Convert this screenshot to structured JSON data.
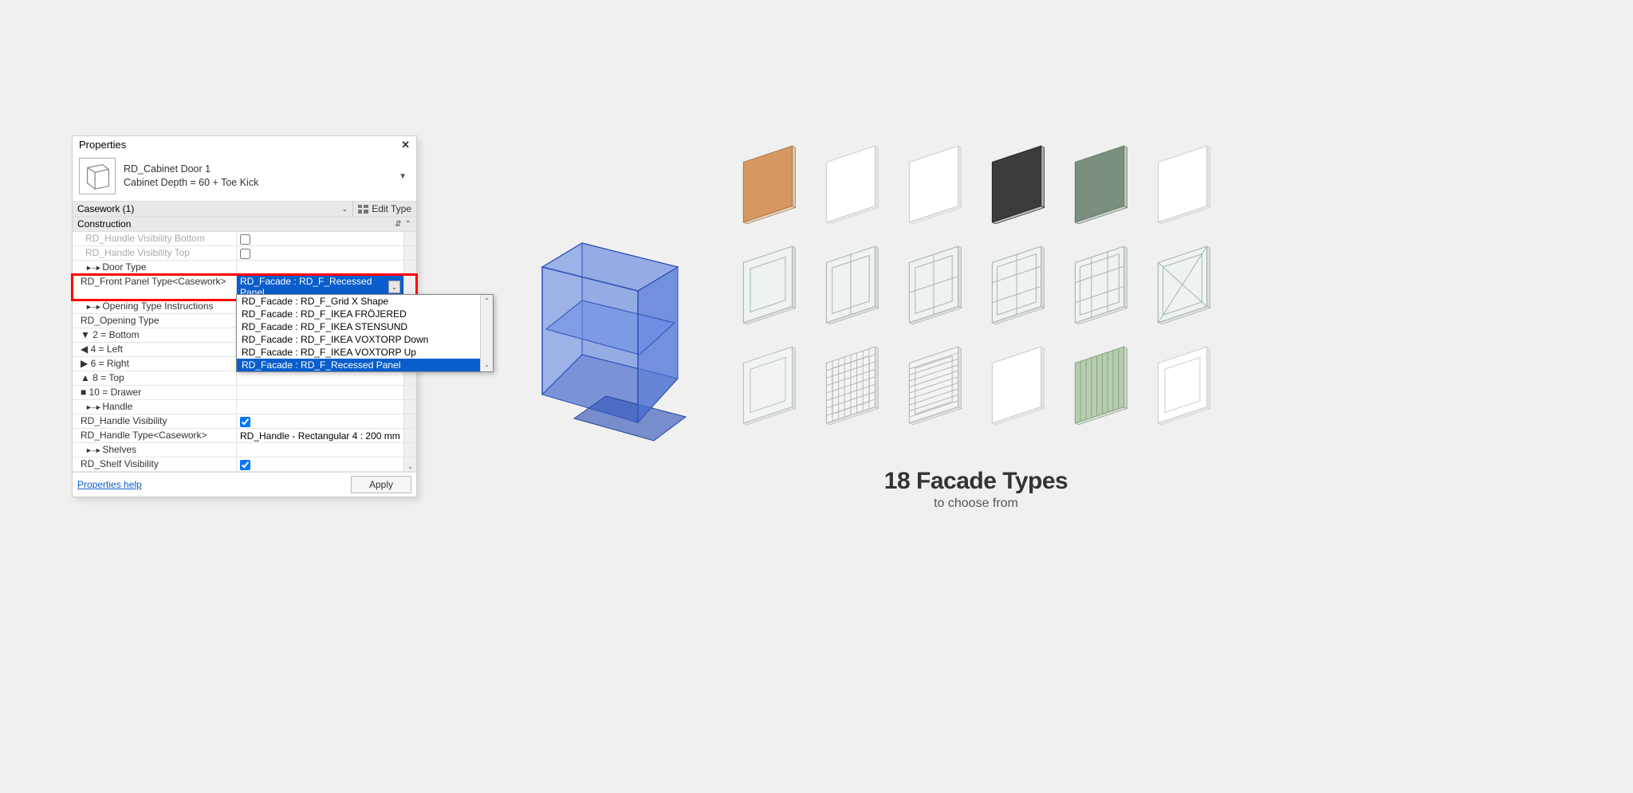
{
  "panel": {
    "title": "Properties",
    "family_name": "RD_Cabinet Door 1",
    "family_type": "Cabinet Depth = 60 + Toe Kick",
    "selector": "Casework (1)",
    "edit_type_label": "Edit Type",
    "group_label": "Construction",
    "help_link": "Properties help",
    "apply_label": "Apply"
  },
  "rows": {
    "handle_vis_bottom": "RD_Handle Visibility Bottom",
    "handle_vis_top": "RD_Handle Visibility Top",
    "door_type": "Door Type",
    "front_panel_type": "RD_Front Panel Type<Casework>",
    "front_panel_value": "RD_Facade : RD_F_Recessed Panel",
    "opening_instr": "Opening Type Instructions",
    "opening_type": "RD_Opening Type",
    "bottom": "2 = Bottom",
    "left": "4 = Left",
    "right": "6 = Right",
    "top": "8 = Top",
    "drawer": "10 = Drawer",
    "handle": "Handle",
    "handle_vis": "RD_Handle Visibility",
    "handle_type": "RD_Handle Type<Casework>",
    "handle_type_val": "RD_Handle - Rectangular 4 : 200 mm",
    "shelves": "Shelves",
    "shelf_vis": "RD_Shelf Visibility"
  },
  "dropdown": {
    "items": [
      "RD_Facade : RD_F_Grid X Shape",
      "RD_Facade : RD_F_IKEA FRÖJERED",
      "RD_Facade : RD_F_IKEA STENSUND",
      "RD_Facade : RD_F_IKEA VOXTORP Down",
      "RD_Facade : RD_F_IKEA VOXTORP Up",
      "RD_Facade : RD_F_Recessed Panel"
    ]
  },
  "facades": [
    {
      "name": "flat-orange",
      "fill": "#d69860",
      "stroke": "#b07a48",
      "pattern": "none"
    },
    {
      "name": "flat-white-1",
      "fill": "#ffffff",
      "stroke": "#cfcfcf",
      "pattern": "none"
    },
    {
      "name": "flat-white-2",
      "fill": "#ffffff",
      "stroke": "#cfcfcf",
      "pattern": "none"
    },
    {
      "name": "flat-dark",
      "fill": "#3c3c3c",
      "stroke": "#2a2a2a",
      "pattern": "none"
    },
    {
      "name": "flat-green",
      "fill": "#7a8f7e",
      "stroke": "#667a6a",
      "pattern": "none"
    },
    {
      "name": "flat-white-3",
      "fill": "#ffffff",
      "stroke": "#cfcfcf",
      "pattern": "none"
    },
    {
      "name": "glass-1pane",
      "fill": "#eef3f0",
      "stroke": "#aab5b0",
      "pattern": "frame"
    },
    {
      "name": "glass-2pane-h",
      "fill": "#eef3f0",
      "stroke": "#aab5b0",
      "pattern": "split-h"
    },
    {
      "name": "glass-4pane",
      "fill": "#eef3f0",
      "stroke": "#aab5b0",
      "pattern": "grid2"
    },
    {
      "name": "glass-6pane",
      "fill": "#eef3f0",
      "stroke": "#aab5b0",
      "pattern": "grid3x2"
    },
    {
      "name": "glass-9pane",
      "fill": "#eef3f0",
      "stroke": "#aab5b0",
      "pattern": "grid3"
    },
    {
      "name": "glass-x",
      "fill": "#eef3f0",
      "stroke": "#aab5b0",
      "pattern": "x"
    },
    {
      "name": "recessed-1",
      "fill": "#f1f4f2",
      "stroke": "#b8c0bb",
      "pattern": "frame"
    },
    {
      "name": "mesh",
      "fill": "#f3f3f3",
      "stroke": "#b8b8b8",
      "pattern": "mesh"
    },
    {
      "name": "louver",
      "fill": "#f3f3f3",
      "stroke": "#b8b8b8",
      "pattern": "louver"
    },
    {
      "name": "curved",
      "fill": "#ffffff",
      "stroke": "#cfcfcf",
      "pattern": "none"
    },
    {
      "name": "slat-green",
      "fill": "#b8ccb0",
      "stroke": "#8aa684",
      "pattern": "slat"
    },
    {
      "name": "recessed-2",
      "fill": "#ffffff",
      "stroke": "#cfcfcf",
      "pattern": "frame"
    }
  ],
  "caption": {
    "big": "18 Facade Types",
    "small": "to choose from"
  }
}
